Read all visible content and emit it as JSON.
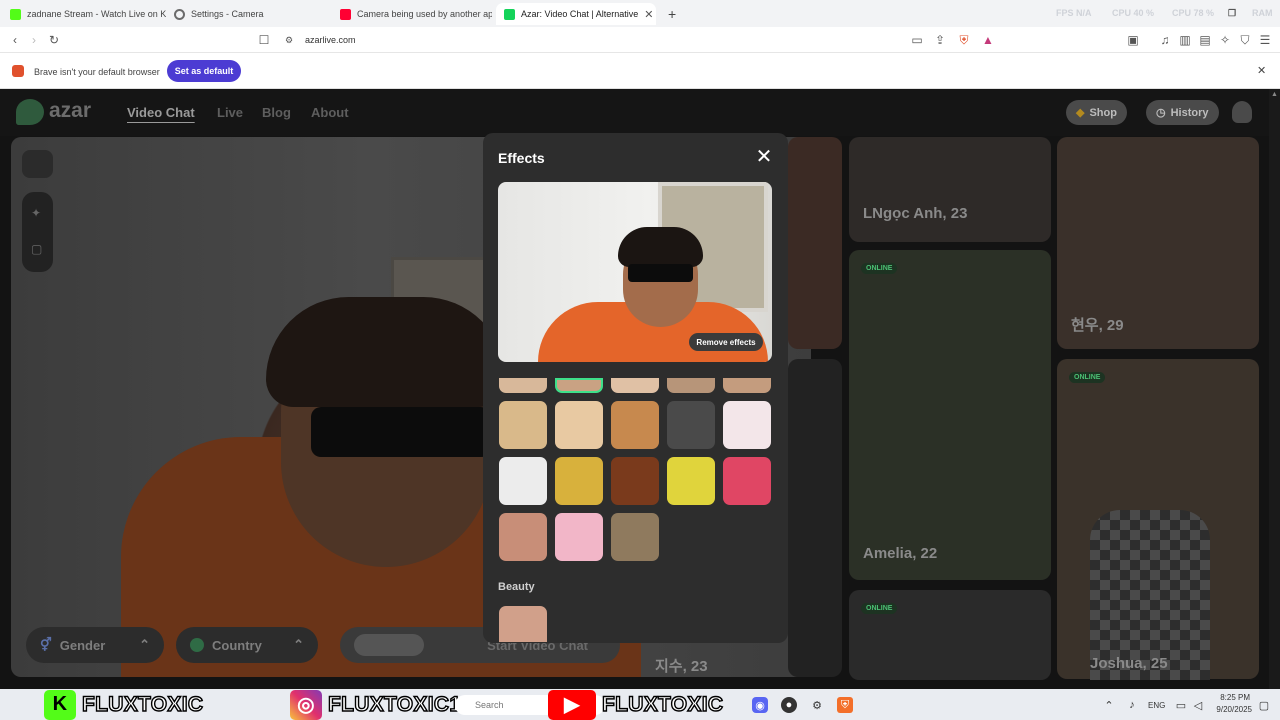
{
  "tabs": [
    {
      "title": "zadnane Stream - Watch Live on Kick",
      "fav_color": "#53fc18"
    },
    {
      "title": "Settings - Camera",
      "fav_color": "#6b6b6b"
    },
    {
      "title": "Camera being used by another appli",
      "fav_color": "#ff0033"
    },
    {
      "title": "Azar: Video Chat | Alternative",
      "fav_color": "#14d35a"
    }
  ],
  "perf": {
    "fps": "FPS  N/A",
    "cpu": "CPU  40 %",
    "gpu": "CPU  78 %",
    "ram": "RAM"
  },
  "address": {
    "url": "azarlive.com"
  },
  "infobar": {
    "message": "Brave isn't your default browser",
    "button": "Set as default"
  },
  "site": {
    "logo": "azar",
    "nav": [
      "Video Chat",
      "Live",
      "Blog",
      "About"
    ],
    "shop": "Shop",
    "history": "History"
  },
  "controls": {
    "gender": "Gender",
    "country": "Country",
    "start": "Start Video Chat"
  },
  "profiles": [
    {
      "name": "LNgọc Anh, 23",
      "online": ""
    },
    {
      "name": "현우, 29",
      "online": ""
    },
    {
      "name": "Amelia, 22",
      "online": "ONLINE"
    },
    {
      "name": "Joshua, 25",
      "online": "ONLINE"
    },
    {
      "name": "지수, 23",
      "online": "ONLINE"
    }
  ],
  "modal": {
    "title": "Effects",
    "remove_label": "Remove effects",
    "beauty_label": "Beauty",
    "effects": [
      {
        "name": "panda-mask",
        "color": "#d9b98a"
      },
      {
        "name": "glasses-woman",
        "color": "#e8c9a2"
      },
      {
        "name": "hamster",
        "color": "#c7894e"
      },
      {
        "name": "zebra",
        "color": "#4a4a4a"
      },
      {
        "name": "cartoon-face",
        "color": "#f3e6e9"
      },
      {
        "name": "googly-eyes",
        "color": "#ececec"
      },
      {
        "name": "flip-flop",
        "color": "#d8b13c"
      },
      {
        "name": "leopard",
        "color": "#7a3a1c"
      },
      {
        "name": "yellow-mask",
        "color": "#e0d43c"
      },
      {
        "name": "heart-face",
        "color": "#e04664"
      },
      {
        "name": "makeup-woman",
        "color": "#c88e78"
      },
      {
        "name": "bunny-ears",
        "color": "#f2b6c8"
      },
      {
        "name": "sunglasses-woman",
        "color": "#8f7a5e"
      }
    ]
  },
  "taskbar": {
    "brand_kick": "FLUXTOXIC",
    "brand_instagram": "FLUXTOXIC1",
    "brand_youtube": "FLUXTOXIC",
    "search": "Search",
    "lang": "ENG",
    "time": "8:25 PM",
    "date": "9/20/2025"
  }
}
